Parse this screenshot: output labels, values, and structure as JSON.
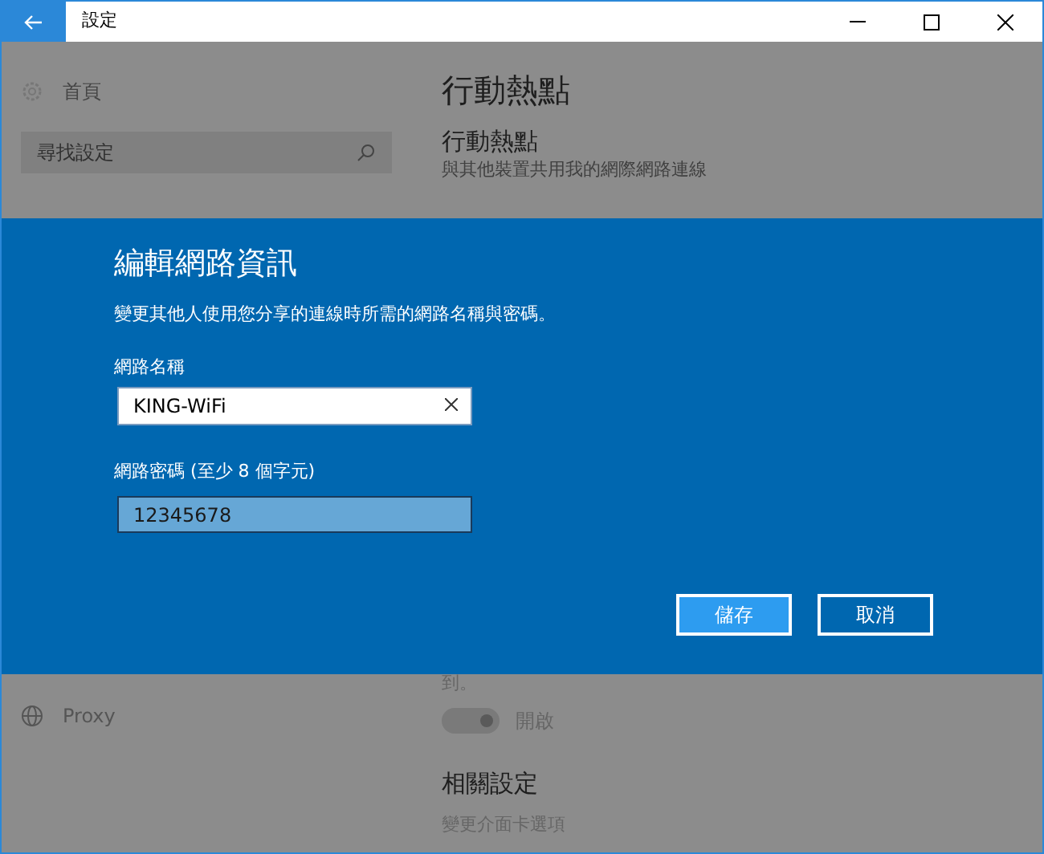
{
  "window": {
    "title": "設定"
  },
  "sidebar": {
    "home": "首頁",
    "search": {
      "placeholder": "尋找設定"
    },
    "items": [
      {
        "label": "Proxy"
      }
    ]
  },
  "page": {
    "title": "行動熱點",
    "section": "行動熱點",
    "description": "與其他裝置共用我的網際網路連線",
    "note_fragment": "到。",
    "toggle": {
      "on": true,
      "label": "開啟"
    },
    "related": "相關設定",
    "related_link": "變更介面卡選項"
  },
  "dialog": {
    "title": "編輯網路資訊",
    "description": "變更其他人使用您分享的連線時所需的網路名稱與密碼。",
    "name_label": "網路名稱",
    "name_value": "KING-WiFi",
    "password_label": "網路密碼 (至少 8 個字元)",
    "password_value": "12345678",
    "buttons": [
      {
        "label": "儲存",
        "kind": "primary"
      },
      {
        "label": "取消",
        "kind": "secondary"
      }
    ]
  }
}
